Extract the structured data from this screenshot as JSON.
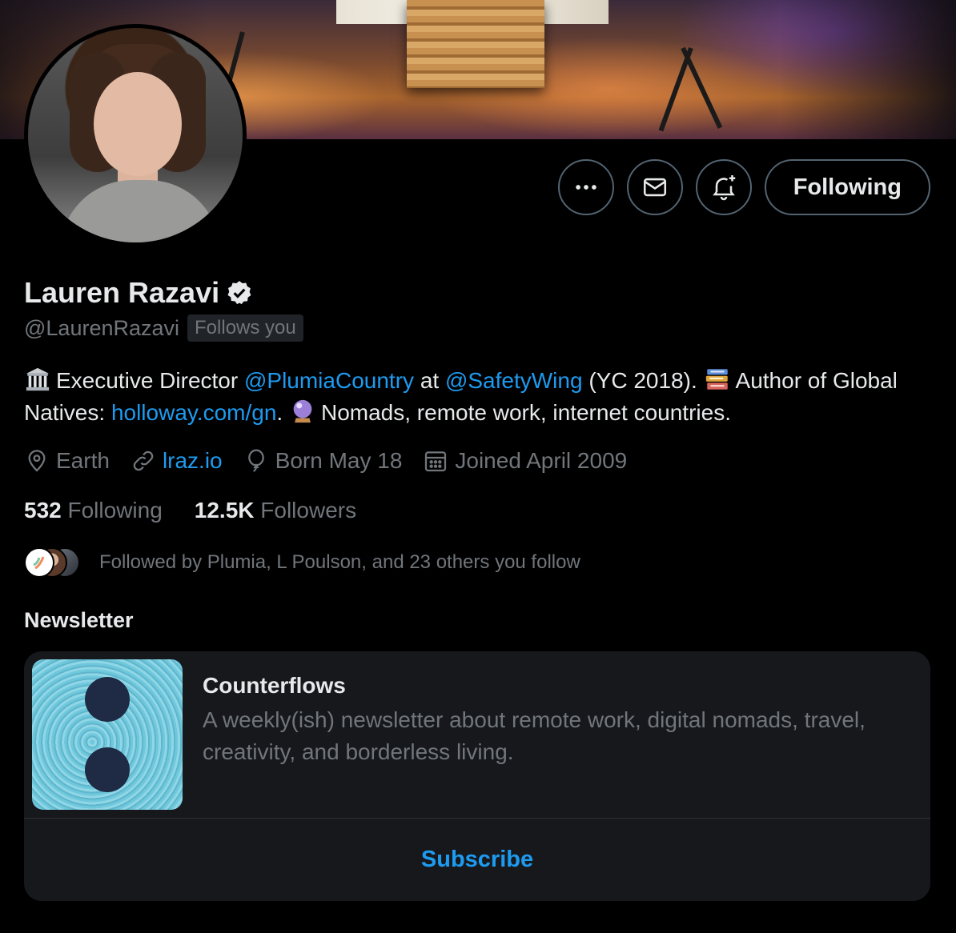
{
  "profile": {
    "name": "Lauren Razavi",
    "handle": "@LaurenRazavi",
    "follows_you": "Follows you",
    "verified": true
  },
  "actions": {
    "more_icon": "more-icon",
    "message_icon": "mail-icon",
    "notify_icon": "bell-plus-icon",
    "follow_label": "Following"
  },
  "bio": {
    "emoji1": "classical-building",
    "text1": "Executive Director",
    "mention1": "@PlumiaCountry",
    "text2": "at",
    "mention2": "@SafetyWing",
    "text3": "(YC 2018).",
    "emoji2": "books",
    "text4": "Author of Global Natives:",
    "link": "holloway.com/gn",
    "text5": ".",
    "emoji3": "crystal-ball",
    "text6": "Nomads, remote work, internet countries."
  },
  "meta": {
    "location": "Earth",
    "website": "lraz.io",
    "birthday": "Born May 18",
    "joined": "Joined April 2009"
  },
  "counts": {
    "following_num": "532",
    "following_label": "Following",
    "followers_num": "12.5K",
    "followers_label": "Followers"
  },
  "followed_by": "Followed by Plumia, L Poulson, and 23 others you follow",
  "newsletter": {
    "section_title": "Newsletter",
    "name": "Counterflows",
    "description": "A weekly(ish) newsletter about remote work, digital nomads, travel, creativity, and borderless living.",
    "subscribe_label": "Subscribe"
  },
  "colors": {
    "accent": "#1d9bf0",
    "muted": "#71767b",
    "text": "#e7e9ea",
    "border": "#536471",
    "card_bg": "#16181c"
  }
}
